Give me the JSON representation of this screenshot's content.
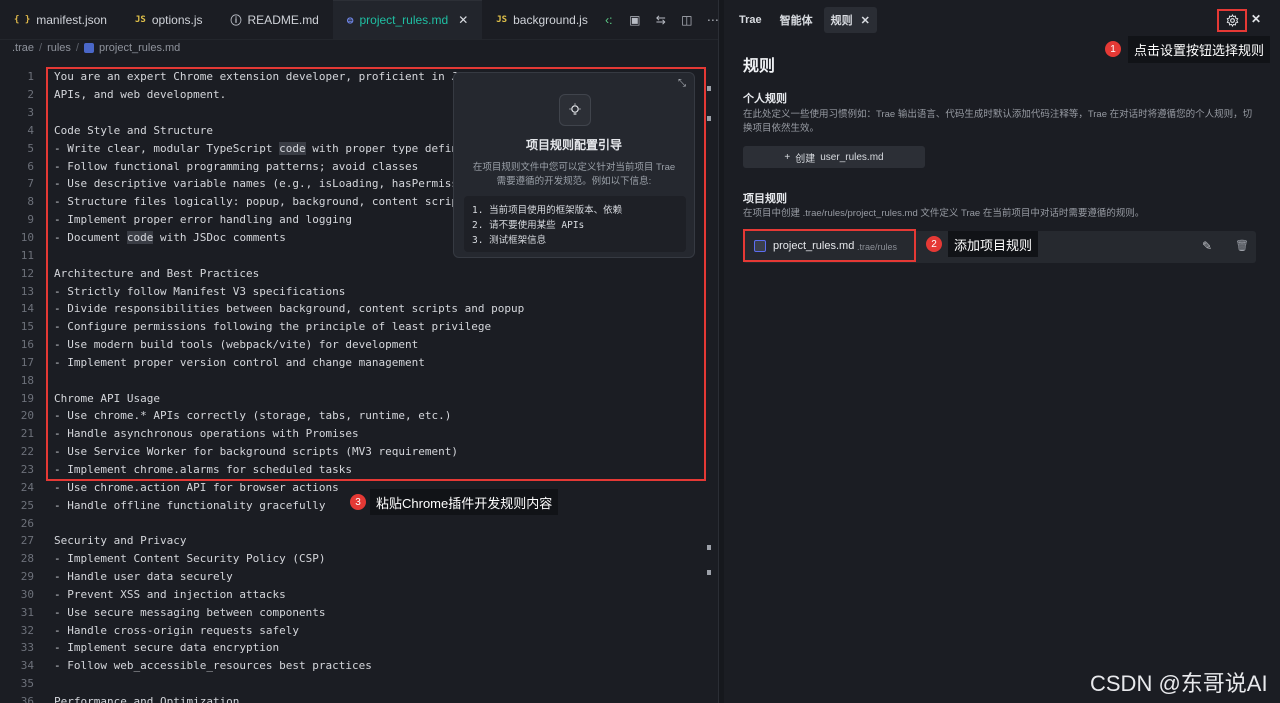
{
  "editor": {
    "tabs": [
      {
        "icon": "{ }",
        "label": "manifest.json",
        "active": false
      },
      {
        "icon": "JS",
        "label": "options.js",
        "active": false
      },
      {
        "icon": "ⓘ",
        "label": "README.md",
        "active": false
      },
      {
        "icon": "⊜",
        "label": "project_rules.md",
        "active": true
      },
      {
        "icon": "JS",
        "label": "background.js",
        "active": false
      }
    ],
    "breadcrumb": [
      ".trae",
      "rules",
      "project_rules.md"
    ],
    "lines": [
      "You are an expert Chrome extension developer, proficient in Jav",
      "APIs, and web development.",
      "",
      "Code Style and Structure",
      "- Write clear, modular TypeScript code with proper type definit",
      "- Follow functional programming patterns; avoid classes",
      "- Use descriptive variable names (e.g., isLoading, hasPermissio",
      "- Structure files logically: popup, background, content scripts",
      "- Implement proper error handling and logging",
      "- Document code with JSDoc comments",
      "",
      "Architecture and Best Practices",
      "- Strictly follow Manifest V3 specifications",
      "- Divide responsibilities between background, content scripts and popup",
      "- Configure permissions following the principle of least privilege",
      "- Use modern build tools (webpack/vite) for development",
      "- Implement proper version control and change management",
      "",
      "Chrome API Usage",
      "- Use chrome.* APIs correctly (storage, tabs, runtime, etc.)",
      "- Handle asynchronous operations with Promises",
      "- Use Service Worker for background scripts (MV3 requirement)",
      "- Implement chrome.alarms for scheduled tasks",
      "- Use chrome.action API for browser actions",
      "- Handle offline functionality gracefully",
      "",
      "Security and Privacy",
      "- Implement Content Security Policy (CSP)",
      "- Handle user data securely",
      "- Prevent XSS and injection attacks",
      "- Use secure messaging between components",
      "- Handle cross-origin requests safely",
      "- Implement secure data encryption",
      "- Follow web_accessible_resources best practices",
      "",
      "Performance and Optimization"
    ],
    "highlight_word": "code"
  },
  "guide": {
    "title": "项目规则配置引导",
    "description": "在项目规则文件中您可以定义针对当前项目 Trae 需要遵循的开发规范。例如以下信息:",
    "items": [
      "1. 当前项目使用的框架版本、依赖",
      "2. 请不要使用某些 APIs",
      "3. 测试框架信息"
    ]
  },
  "callouts": [
    {
      "num": "1",
      "text": "点击设置按钮选择规则"
    },
    {
      "num": "2",
      "text": "添加项目规则"
    },
    {
      "num": "3",
      "text": "粘贴Chrome插件开发规则内容"
    }
  ],
  "panel": {
    "tabs": [
      "Trae",
      "智能体",
      "规则"
    ],
    "title": "规则",
    "personal": {
      "title": "个人规则",
      "desc": "在此处定义一些使用习惯例如：Trae 输出语言、代码生成时默认添加代码注释等，Trae 在对话时将遵循您的个人规则，切换项目依然生效。",
      "button": "创建",
      "button_file": "user_rules.md"
    },
    "project": {
      "title": "项目规则",
      "desc": "在项目中创建 .trae/rules/project_rules.md 文件定义 Trae 在当前项目中对话时需要遵循的规则。",
      "file": "project_rules.md",
      "path": ".trae/rules"
    }
  },
  "watermark": "CSDN @东哥说AI"
}
